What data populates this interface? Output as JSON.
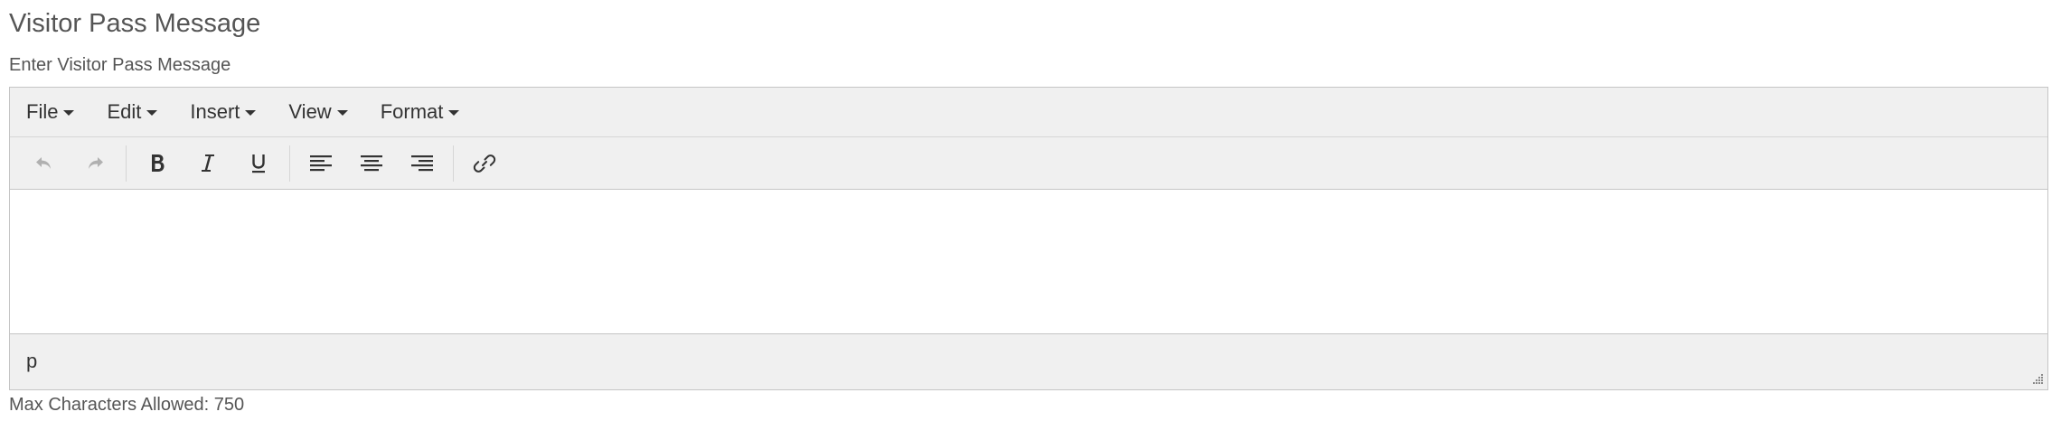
{
  "section": {
    "title": "Visitor Pass Message",
    "label": "Enter Visitor Pass Message"
  },
  "editor": {
    "menu": [
      {
        "label": "File"
      },
      {
        "label": "Edit"
      },
      {
        "label": "Insert"
      },
      {
        "label": "View"
      },
      {
        "label": "Format"
      }
    ],
    "toolbar": {
      "history": [
        "undo-icon",
        "redo-icon"
      ],
      "formatting": [
        "bold-icon",
        "italic-icon",
        "underline-icon"
      ],
      "alignment": [
        "align-left-icon",
        "align-center-icon",
        "align-right-icon"
      ],
      "insert": [
        "link-icon"
      ]
    },
    "content": "",
    "statusbar_path": "p"
  },
  "footer": {
    "char_limit": "Max Characters Allowed: 750"
  },
  "colors": {
    "chrome_bg": "#f0f0f0",
    "border": "#c5c5c5",
    "text": "#555555",
    "icon": "#333333",
    "disabled_icon": "#b0b0b0"
  }
}
